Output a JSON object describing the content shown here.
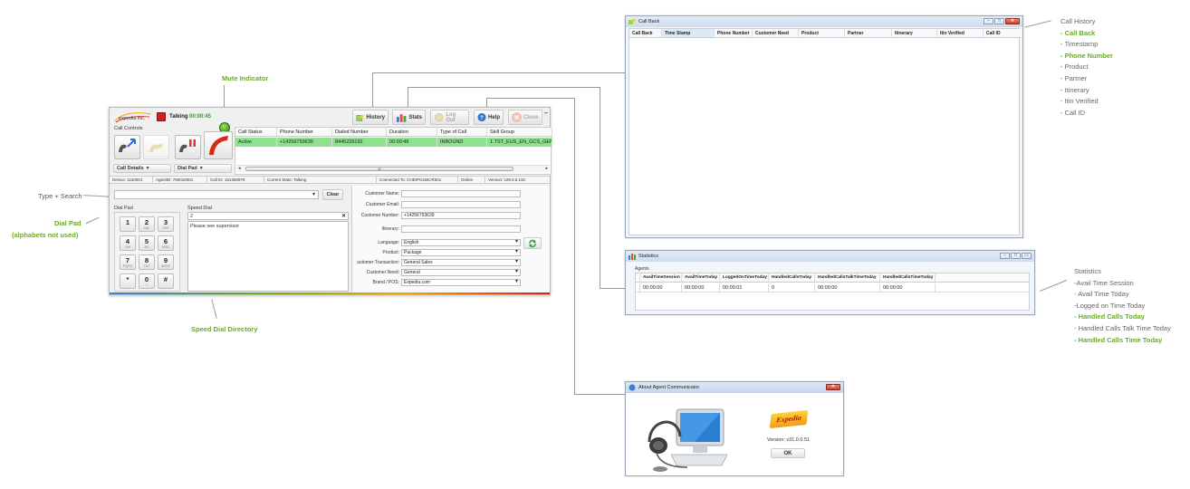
{
  "annotations": {
    "mute_indicator": "Mute Indicator",
    "type_search": "Type + Search",
    "dial_pad_line1": "Dial Pad",
    "dial_pad_line2": "(alphabets not used)",
    "speed_dial_directory": "Speed Dial Directory",
    "call_history": [
      "Call History",
      "- Call Back",
      "- Timestamp",
      "- Phone Number",
      "- Product",
      "- Partner",
      "- Itinerary",
      "- Itin Verified",
      "- Call ID"
    ],
    "call_history_green": [
      false,
      true,
      false,
      true,
      false,
      false,
      false,
      false,
      false
    ],
    "statistics": [
      "Statistics",
      "-Avail Time Session",
      "- Avail Time Today",
      "-Logged on Time Today",
      "- Handled Calls Today",
      "- Handled Calls Talk Time Today",
      "- Handled Calls Time Today"
    ],
    "statistics_green": [
      false,
      false,
      false,
      false,
      true,
      false,
      true
    ]
  },
  "main": {
    "logo": "expedia inc.",
    "status": "Talking",
    "timer": "00:00:45",
    "call_controls_label": "Call Controls",
    "toolbar": {
      "history": "History",
      "stats": "Stats",
      "logout": "Log Out",
      "help": "Help",
      "close": "Close"
    },
    "grid_columns": [
      "Call Status",
      "Phone Number",
      "Dialed Number",
      "Duration",
      "Type of Call",
      "Skill Group"
    ],
    "grid_row": [
      "Active",
      "+14256793639",
      "8445226192",
      "00:00:46",
      "INBOUND",
      "1.TST_EUS_EN_GCS_GEN_"
    ],
    "scroll_label": "III",
    "call_details_btn": "Call Details",
    "dial_pad_btn": "Dial Pad",
    "statusbar": [
      "Device: 1160001",
      "AgentID: 760010001",
      "Call ID: 151380979",
      "Current State: Talking",
      "Connected To: CHEIPG1BICR501",
      "Online",
      "Version: v29.0.0.118"
    ],
    "clear_btn": "Clear",
    "dial_pad_label": "Dial Pad",
    "speed_dial_label": "Speed Dial",
    "speed_dial_input": "2",
    "speed_dial_item": "Please see supervisor",
    "keys": [
      {
        "d": "1",
        "l": ""
      },
      {
        "d": "2",
        "l": "ABC"
      },
      {
        "d": "3",
        "l": "DEF"
      },
      {
        "d": "4",
        "l": "GHI"
      },
      {
        "d": "5",
        "l": "JKL"
      },
      {
        "d": "6",
        "l": "MNO"
      },
      {
        "d": "7",
        "l": "PQRS"
      },
      {
        "d": "8",
        "l": "TUV"
      },
      {
        "d": "9",
        "l": "WXYZ"
      },
      {
        "d": "*",
        "l": ""
      },
      {
        "d": "0",
        "l": "+"
      },
      {
        "d": "#",
        "l": ""
      }
    ],
    "form": {
      "customer_name_label": "Customer Name:",
      "customer_name": "",
      "customer_email_label": "Customer Email:",
      "customer_email": "",
      "customer_number_label": "Customer Number:",
      "customer_number": "+14256793639",
      "itinerary_label": "Itinerary:",
      "itinerary": "",
      "language_label": "Language:",
      "language": "English",
      "product_label": "Product:",
      "product": "Package",
      "transaction_label": "ustomer Transaction:",
      "transaction": "General Sales",
      "need_label": "Customer Need:",
      "need": "General",
      "brand_label": "Brand / POS:",
      "brand": "Expedia.com"
    }
  },
  "callback": {
    "title": "Call Back",
    "columns": [
      "Call Back",
      "Time Stamp",
      "Phone Number",
      "Customer Need",
      "Product",
      "Partner",
      "Itinerary",
      "Itin Verified",
      "Call ID"
    ]
  },
  "stats": {
    "title": "Statistics",
    "group": "Agents",
    "columns": [
      "AvailTimeSession",
      "AvailTimeToday",
      "LoggedOnTimeToday",
      "HandledCallsToday",
      "HandledCallsTalkTimeToday",
      "HandledCallsTimeToday"
    ],
    "values": [
      "00:00:00",
      "00:00:00",
      "00:00:01",
      "0",
      "00:00:00",
      "00:00:00"
    ]
  },
  "about": {
    "title": "About Agent Communicator",
    "version": "Version:  v31.0.0.51",
    "ok": "OK",
    "logo_text": "Expedia"
  },
  "colors": {
    "accent_green": "#6aab26",
    "active_row": "#8fe08f",
    "timer_green": "#2e9a2e"
  }
}
